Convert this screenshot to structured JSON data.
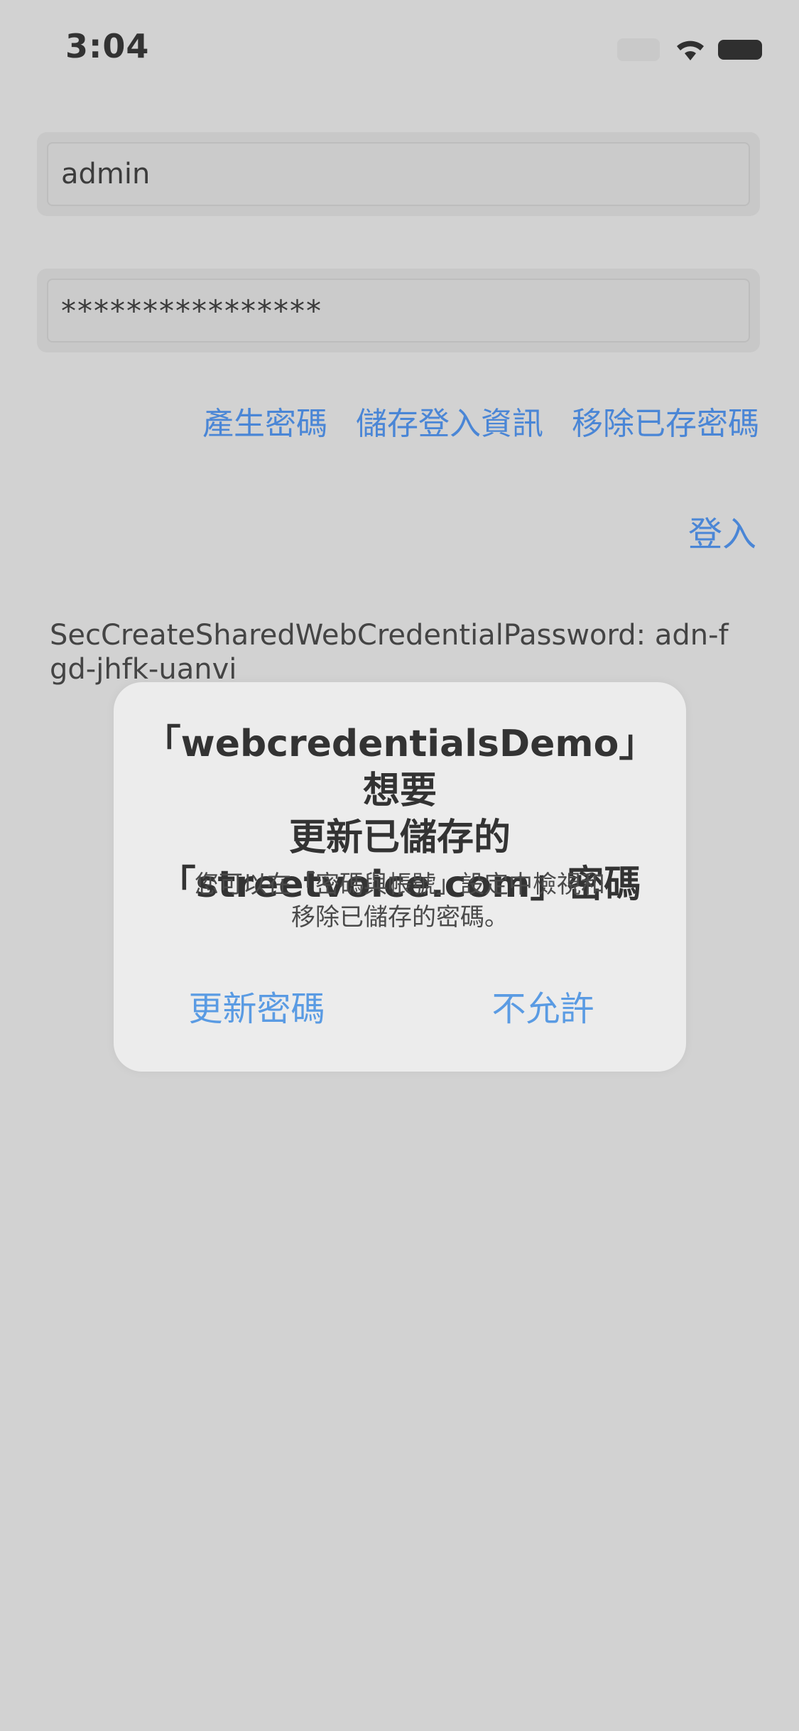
{
  "status_bar": {
    "time": "3:04"
  },
  "form": {
    "username_value": "admin",
    "password_value": "****************"
  },
  "links": {
    "generate_password": "產生密碼",
    "save_credentials": "儲存登入資訊",
    "remove_saved": "移除已存密碼",
    "login": "登入"
  },
  "log": {
    "text": "SecCreateSharedWebCredentialPassword: adn-fgd-jhfk-uanvi"
  },
  "alert": {
    "title_line1": "「webcredentialsDemo」想要",
    "title_line2": "更新已儲存的",
    "title_line3": "「streetvoice.com」密碼",
    "message_line1": "您可以在「密碼與帳號」設定中檢視和",
    "message_line2": "移除已儲存的密碼。",
    "update_button": "更新密碼",
    "cancel_button": "不允許"
  },
  "colors": {
    "background": "#d2d2d2",
    "link_blue": "#4a86d6",
    "alert_background": "#ececec"
  },
  "icons": [
    "signal-icon",
    "wifi-icon",
    "battery-icon"
  ]
}
